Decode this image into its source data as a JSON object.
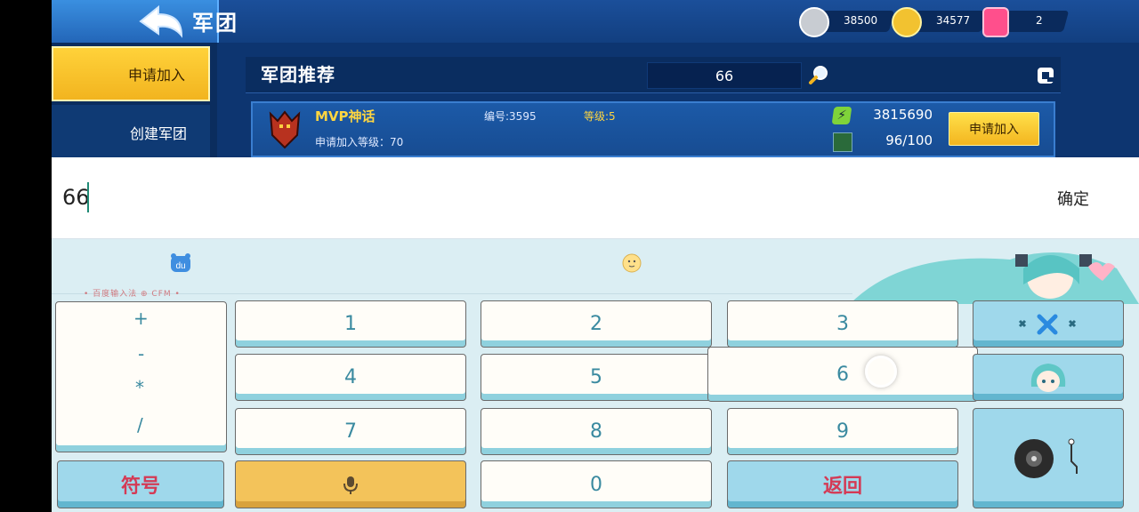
{
  "header": {
    "title": "军团",
    "currencies": [
      {
        "icon": "silver-coin-icon",
        "value": "38500",
        "color": "#c8ccd2"
      },
      {
        "icon": "gold-coin-icon",
        "value": "34577",
        "color": "#f2c230"
      },
      {
        "icon": "gem-icon",
        "value": "2",
        "color": "#ff4f8c"
      }
    ]
  },
  "sidebar": {
    "items": [
      {
        "label": "申请加入",
        "active": true
      },
      {
        "label": "创建军团",
        "active": false
      }
    ]
  },
  "panel": {
    "title": "军团推荐",
    "search_value": "66"
  },
  "guild": {
    "name": "MVP神话",
    "required_level": "申请加入等级：70",
    "id": "编号:3595",
    "level": "等级:5",
    "power": "3815690",
    "members": "96/100",
    "apply_label": "申请加入"
  },
  "input": {
    "value": "66",
    "confirm_label": "确定"
  },
  "keyboard": {
    "brand": "• 百度输入法 ⊕ CFM •",
    "operators": [
      "+",
      "-",
      "*",
      "/"
    ],
    "digits": [
      "1",
      "2",
      "3",
      "4",
      "5",
      "6",
      "7",
      "8",
      "9",
      "0"
    ],
    "symbol_label": "符号",
    "return_label": "返回"
  },
  "colors": {
    "accent_yellow": "#f2b41f",
    "game_blue": "#0d3570",
    "keyboard_bg": "#dbeef3",
    "key_label": "#3a8aa0"
  }
}
